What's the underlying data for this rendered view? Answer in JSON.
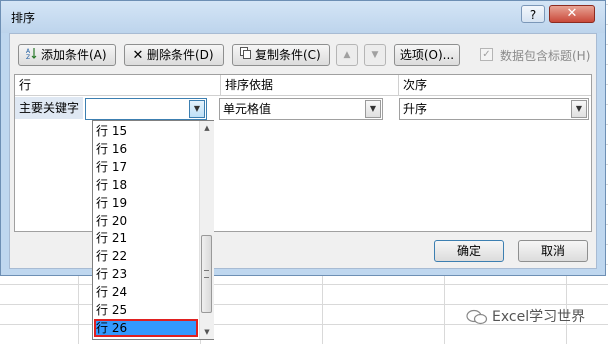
{
  "dialog": {
    "title": "排序",
    "help_label": "?",
    "close_label": "✕"
  },
  "toolbar": {
    "add_label": "添加条件(A)",
    "delete_label": "删除条件(D)",
    "copy_label": "复制条件(C)",
    "up_label": "▲",
    "down_label": "▼",
    "options_label": "选项(O)...",
    "header_check_label": "数据包含标题(H)",
    "header_check_mark": "✓"
  },
  "table": {
    "col_column": "行",
    "col_sort_on": "排序依据",
    "col_order": "次序",
    "row_label": "主要关键字",
    "key_value": "",
    "sort_on_value": "单元格值",
    "order_value": "升序"
  },
  "dropdown_list": {
    "items": [
      "行 15",
      "行 16",
      "行 17",
      "行 18",
      "行 19",
      "行 20",
      "行 21",
      "行 22",
      "行 23",
      "行 24",
      "行 25",
      "行 26"
    ],
    "selected": "行 26"
  },
  "footer": {
    "ok_label": "确定",
    "cancel_label": "取消"
  },
  "watermark": {
    "text": "Excel学习世界"
  }
}
